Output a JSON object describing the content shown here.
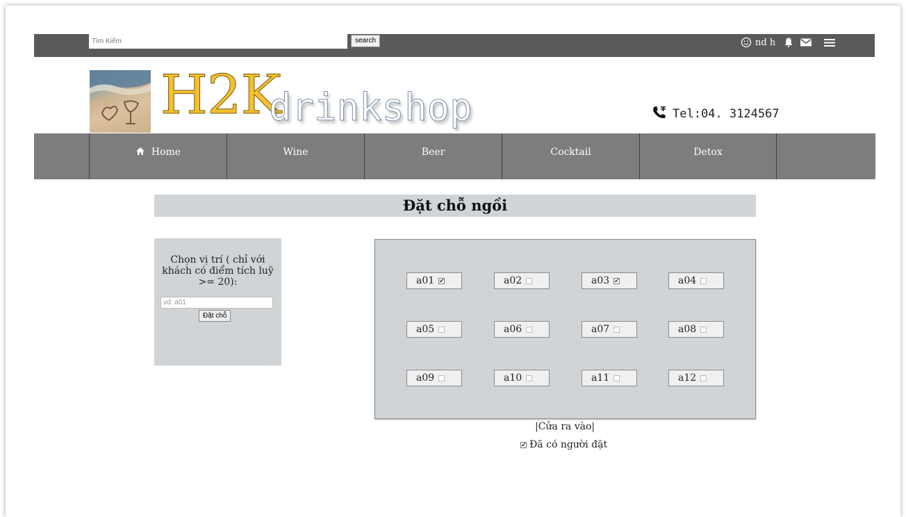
{
  "search": {
    "placeholder": "Tìm Kiếm",
    "button_label": "search"
  },
  "user": {
    "name": "nd h"
  },
  "header": {
    "logo_main": "H2K",
    "logo_sub": "drinkshop",
    "phone_text": "Tel:04. 3124567"
  },
  "nav": {
    "items": [
      {
        "label": "Home"
      },
      {
        "label": "Wine"
      },
      {
        "label": "Beer"
      },
      {
        "label": "Cocktail"
      },
      {
        "label": "Detox"
      }
    ]
  },
  "page": {
    "title": "Đặt chỗ ngồi"
  },
  "reserve": {
    "label": "Chọn vị trí ( chỉ với khách có điểm tích luỹ >= 20):",
    "input_placeholder": "vd: a01",
    "button_label": "Đặt chỗ"
  },
  "seats": [
    {
      "label": "a01",
      "checked": true
    },
    {
      "label": "a02",
      "checked": false
    },
    {
      "label": "a03",
      "checked": true
    },
    {
      "label": "a04",
      "checked": false
    },
    {
      "label": "a05",
      "checked": false
    },
    {
      "label": "a06",
      "checked": false
    },
    {
      "label": "a07",
      "checked": false
    },
    {
      "label": "a08",
      "checked": false
    },
    {
      "label": "a09",
      "checked": false
    },
    {
      "label": "a10",
      "checked": false
    },
    {
      "label": "a11",
      "checked": false
    },
    {
      "label": "a12",
      "checked": false
    }
  ],
  "door_label": "|Cửa ra vào|",
  "legend": {
    "label": "Đã có người đặt"
  },
  "colors": {
    "topbar": "#5a5a5a",
    "nav": "#7d7d7d",
    "panel": "#d0d4d7",
    "logo_yellow": "#f2c12e"
  }
}
